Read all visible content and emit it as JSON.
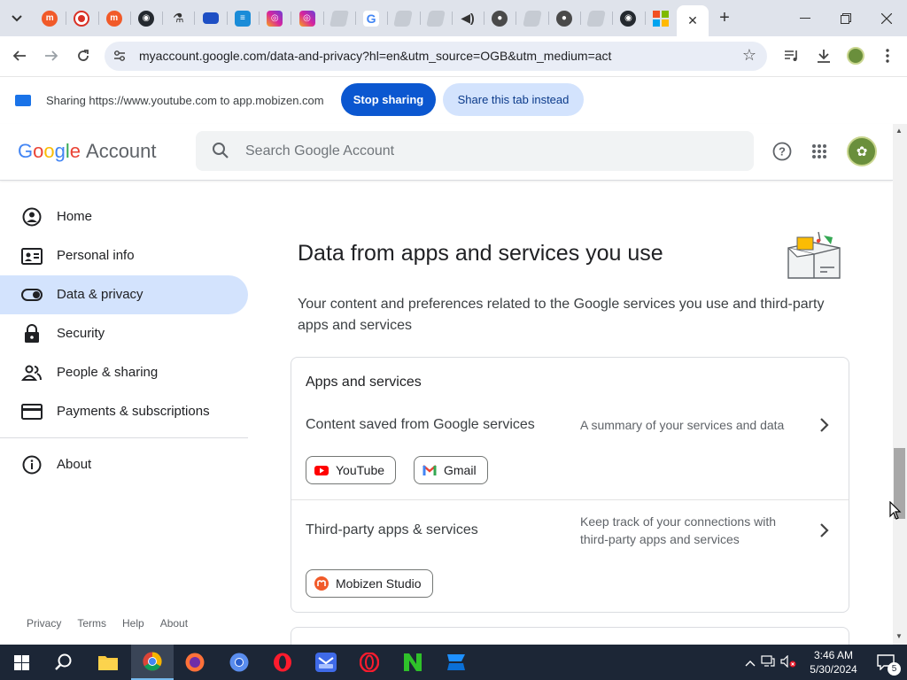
{
  "browser": {
    "tabs_favicons": [
      "mobizen",
      "record",
      "mobizen",
      "github",
      "flask",
      "window",
      "craft",
      "instagram",
      "instagram",
      "generic",
      "google",
      "generic",
      "generic",
      "speaker",
      "person",
      "generic",
      "person",
      "generic",
      "github",
      "microsoft"
    ],
    "active_tab_close": "✕",
    "new_tab": "+",
    "url": "myaccount.google.com/data-and-privacy?hl=en&utm_source=OGB&utm_medium=act"
  },
  "share_bar": {
    "text": "Sharing https://www.youtube.com to app.mobizen.com",
    "stop_label": "Stop sharing",
    "share_tab_label": "Share this tab instead"
  },
  "header": {
    "logo_google": [
      "G",
      "o",
      "o",
      "g",
      "l",
      "e"
    ],
    "logo_account": "Account",
    "search_placeholder": "Search Google Account"
  },
  "sidebar": {
    "items": [
      {
        "label": "Home",
        "icon": "home-icon"
      },
      {
        "label": "Personal info",
        "icon": "id-card-icon"
      },
      {
        "label": "Data & privacy",
        "icon": "toggle-icon",
        "active": true
      },
      {
        "label": "Security",
        "icon": "lock-icon"
      },
      {
        "label": "People & sharing",
        "icon": "people-icon"
      },
      {
        "label": "Payments & subscriptions",
        "icon": "credit-card-icon"
      },
      {
        "label": "About",
        "icon": "info-icon"
      }
    ],
    "footer": [
      "Privacy",
      "Terms",
      "Help",
      "About"
    ]
  },
  "main": {
    "title": "Data from apps and services you use",
    "description": "Your content and preferences related to the Google services you use and third-party apps and services",
    "card": {
      "title": "Apps and services",
      "rows": [
        {
          "title": "Content saved from Google services",
          "description": "A summary of your services and data",
          "chips": [
            "YouTube",
            "Gmail"
          ]
        },
        {
          "title": "Third-party apps & services",
          "description": "Keep track of your connections with third-party apps and services",
          "chips": [
            "Mobizen Studio"
          ]
        }
      ]
    }
  },
  "taskbar": {
    "apps": [
      "windows-start",
      "search",
      "file-explorer",
      "chrome",
      "firefox",
      "chromium",
      "opera",
      "mail",
      "opera-gx",
      "notepad",
      "app"
    ],
    "time": "3:46 AM",
    "date": "5/30/2024",
    "notifications": "5"
  },
  "colors": {
    "accent": "#0b57d0",
    "active_nav": "#d3e3fd",
    "taskbar": "#1c2636"
  }
}
